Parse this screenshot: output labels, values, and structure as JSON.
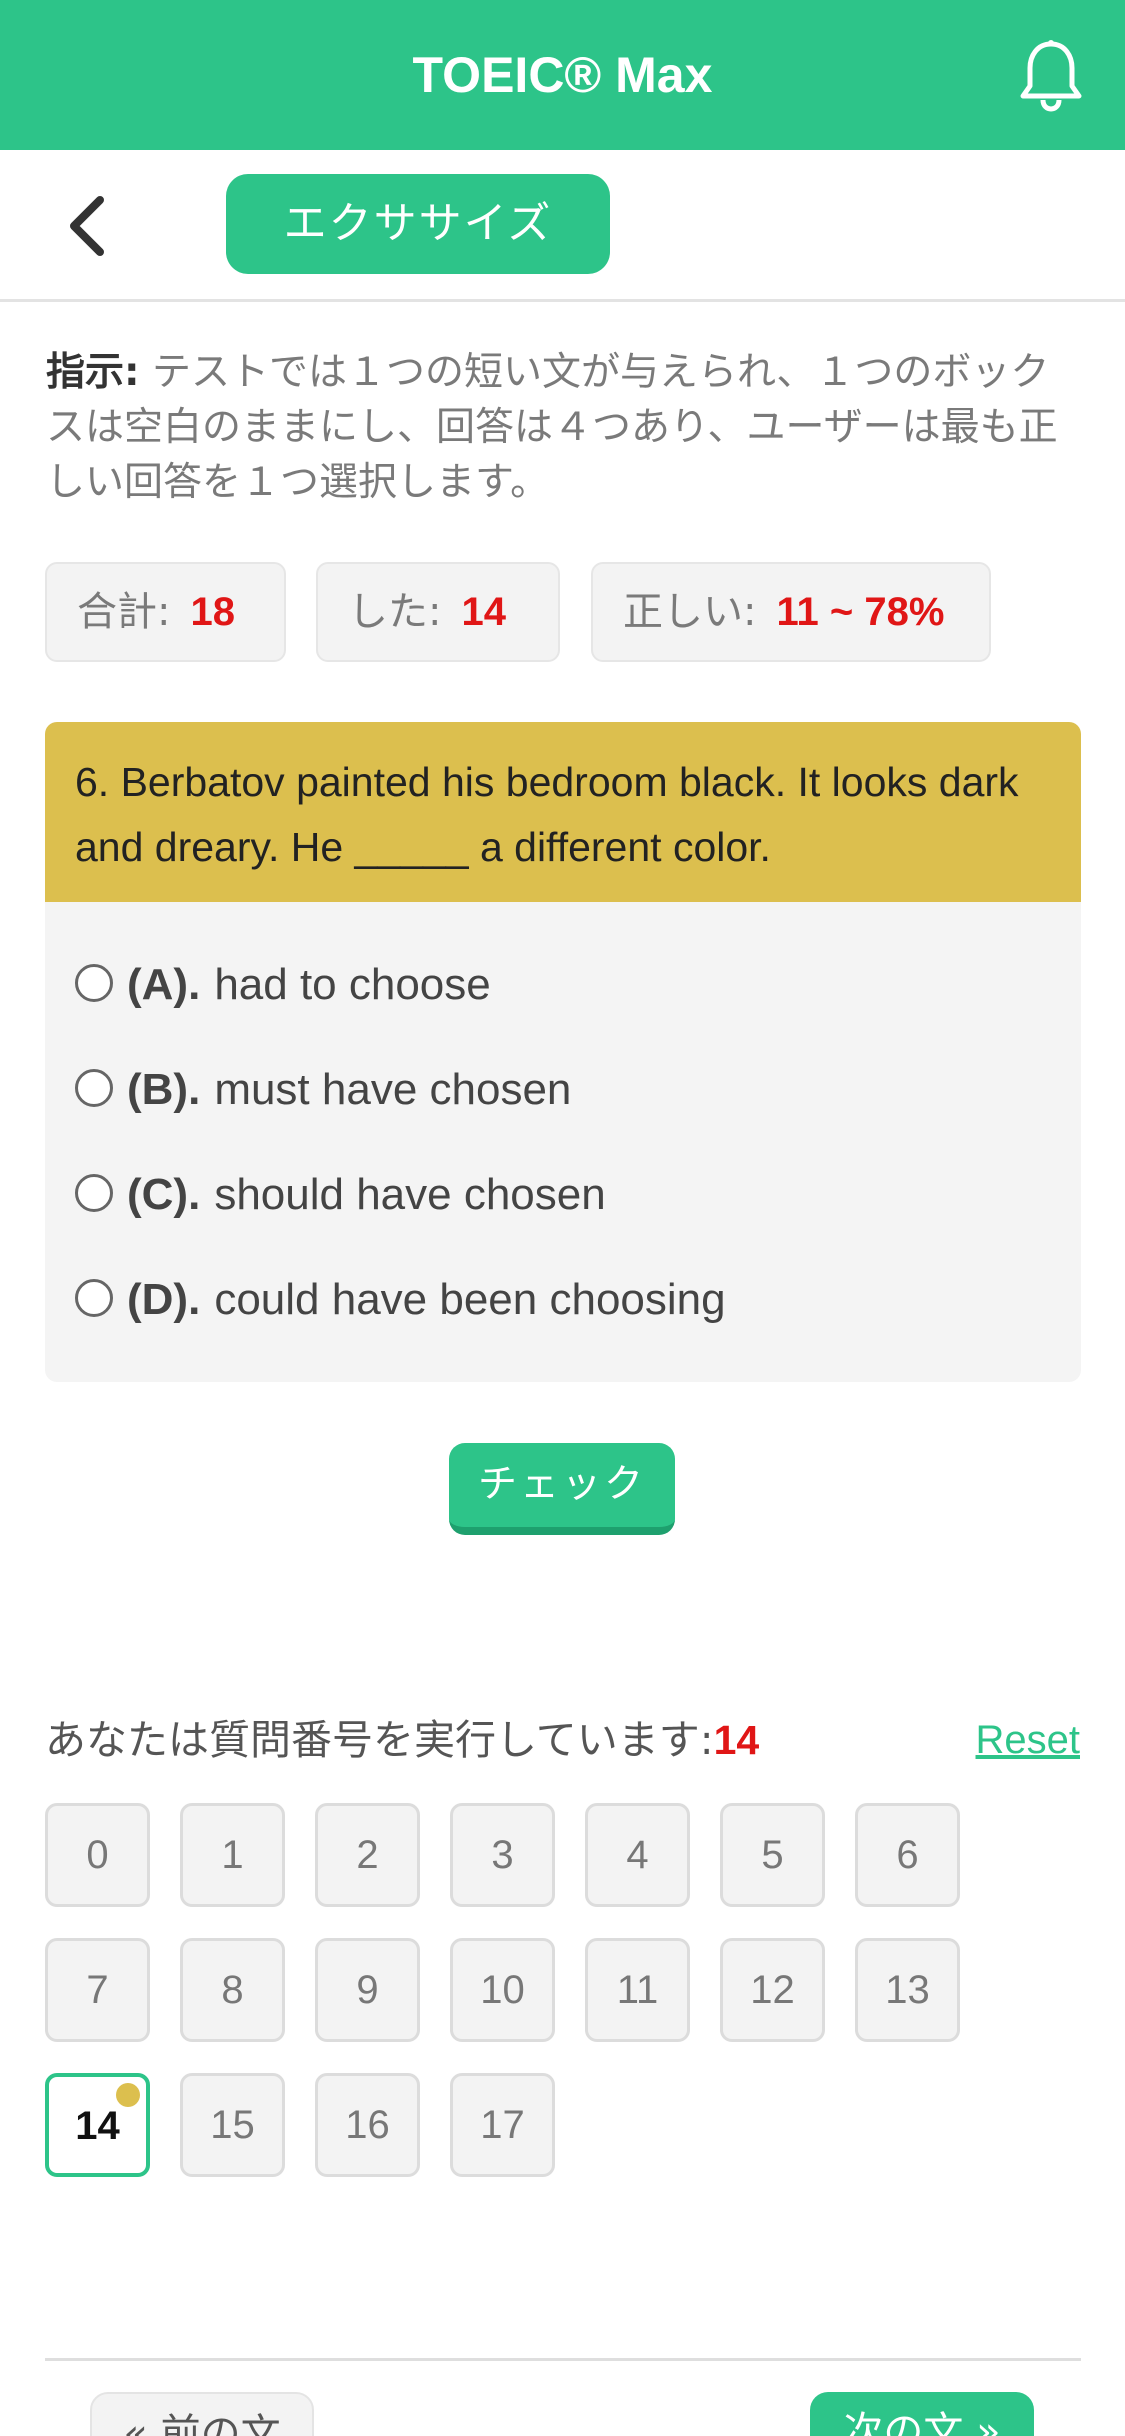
{
  "header": {
    "title": "TOEIC® Max",
    "bell_icon": "bell-icon"
  },
  "subbar": {
    "back_icon": "chevron-left-icon",
    "tab_label": "エクササイズ"
  },
  "instructions": {
    "label": "指示:",
    "text": " テストでは１つの短い文が与えられ、１つのボックスは空白のままにし、回答は４つあり、ユーザーは最も正しい回答を１つ選択します。"
  },
  "stats": {
    "total_label": "合計:",
    "total_value": "18",
    "done_label": "した:",
    "done_value": "14",
    "correct_label": "正しい:",
    "correct_value": "11 ~ 78%"
  },
  "question": {
    "text": "6. Berbatov painted his bedroom black. It looks dark and dreary. He _____ a different color.",
    "options": [
      {
        "letter": "(A).",
        "text": "had to choose"
      },
      {
        "letter": "(B).",
        "text": "must have chosen"
      },
      {
        "letter": "(C).",
        "text": "should have chosen"
      },
      {
        "letter": "(D).",
        "text": "could have been choosing"
      }
    ]
  },
  "check_button": "チェック",
  "progress": {
    "label": "あなたは質問番号を実行しています:",
    "current": "14",
    "reset_label": "Reset"
  },
  "question_numbers": [
    "0",
    "1",
    "2",
    "3",
    "4",
    "5",
    "6",
    "7",
    "8",
    "9",
    "10",
    "11",
    "12",
    "13",
    "14",
    "15",
    "16",
    "17"
  ],
  "nav": {
    "prev_label": "« 前の文",
    "next_label": "次の文 »"
  },
  "colors": {
    "brand": "#2dc489",
    "question_header": "#dcbf4e",
    "highlight": "#e01616"
  }
}
